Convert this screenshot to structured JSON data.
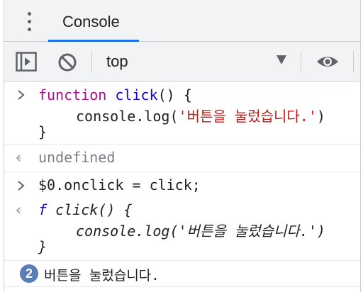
{
  "tabs": {
    "console_label": "Console"
  },
  "toolbar": {
    "context_value": "top"
  },
  "icons": {
    "kebab": "kebab-menu-icon",
    "sidebar": "sidebar-toggle-icon",
    "clear": "clear-console-icon",
    "dropdown": "dropdown-arrow-icon",
    "eye": "eye-icon",
    "input_prompt": "chevron-right-icon",
    "output_prompt": "return-arrow-icon"
  },
  "console": {
    "entry1": {
      "kw": "function",
      "name": "click",
      "sig_rest": "() {",
      "body_pre": "console.log(",
      "body_str": "'버튼을 눌렀습니다.'",
      "body_post": ")",
      "close": "}"
    },
    "result1": "undefined",
    "entry2": {
      "lhs": "$0.onclick",
      "op": "=",
      "rhs": "click;"
    },
    "result2": {
      "f": "f",
      "sig": "click() {",
      "body_pre": "console.log(",
      "body_str": "'버튼을 눌렀습니다.'",
      "body_post": ")",
      "close": "}"
    },
    "log": {
      "count": "2",
      "message": "버튼을 눌렀습니다."
    }
  },
  "colors": {
    "keyword": "#aa0d91",
    "function_name": "#1c00cf",
    "string": "#c41a16",
    "badge": "#5b7cb8",
    "accent": "#1a73e8"
  }
}
